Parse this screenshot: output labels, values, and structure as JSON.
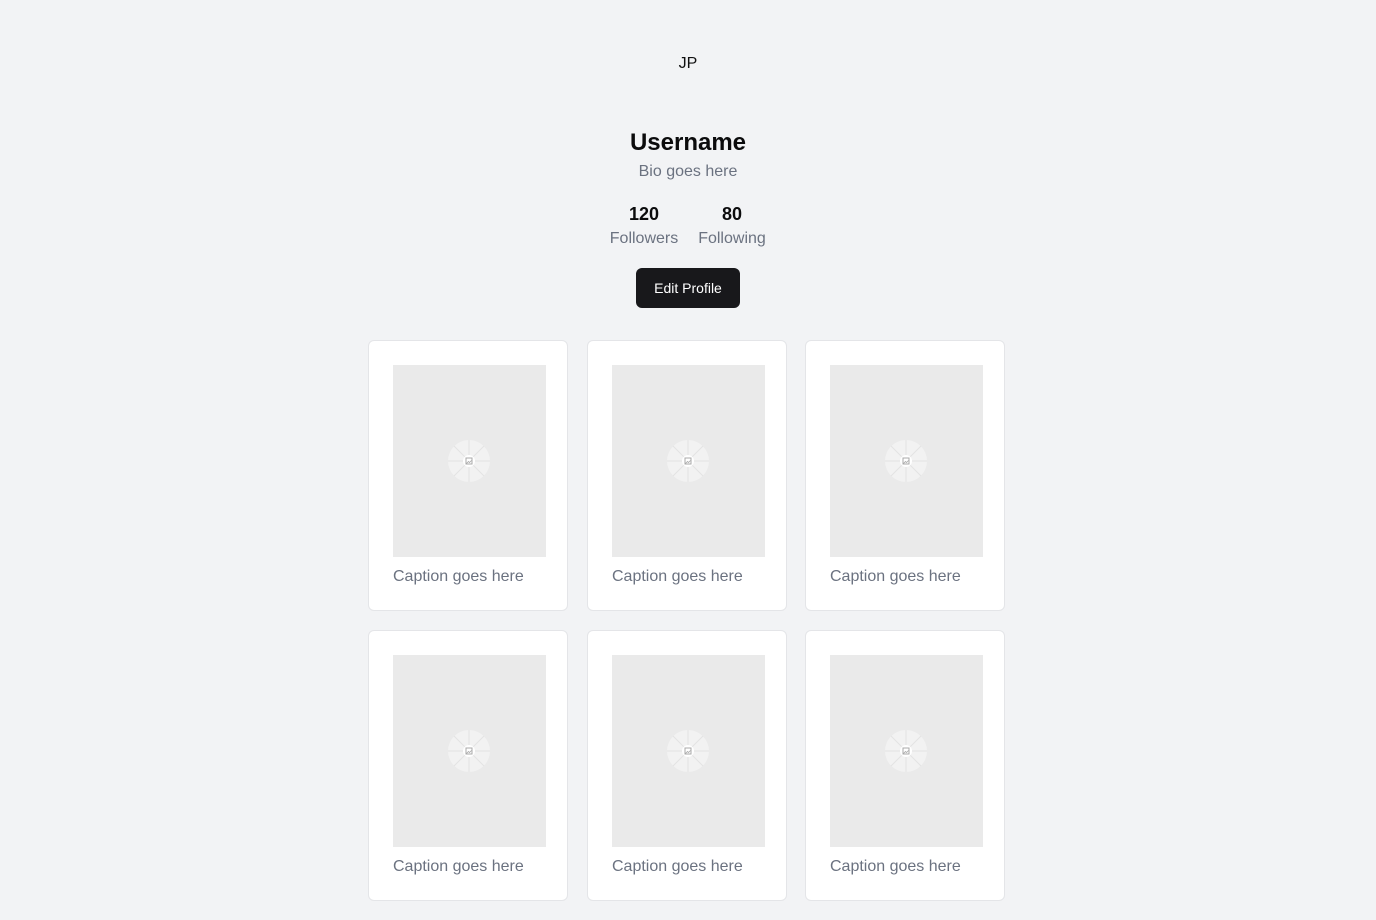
{
  "profile": {
    "avatar_initials": "JP",
    "username": "Username",
    "bio": "Bio goes here",
    "stats": {
      "followers": {
        "value": "120",
        "label": "Followers"
      },
      "following": {
        "value": "80",
        "label": "Following"
      }
    },
    "edit_button_label": "Edit Profile"
  },
  "posts": [
    {
      "caption": "Caption goes here",
      "image_icon": "image-placeholder-icon"
    },
    {
      "caption": "Caption goes here",
      "image_icon": "image-placeholder-icon"
    },
    {
      "caption": "Caption goes here",
      "image_icon": "image-placeholder-icon"
    },
    {
      "caption": "Caption goes here",
      "image_icon": "image-placeholder-icon"
    },
    {
      "caption": "Caption goes here",
      "image_icon": "image-placeholder-icon"
    },
    {
      "caption": "Caption goes here",
      "image_icon": "image-placeholder-icon"
    }
  ],
  "colors": {
    "page_background": "#f2f3f5",
    "button_background": "#18181b",
    "muted_text": "#6b7280",
    "image_placeholder": "#eaeaea"
  }
}
